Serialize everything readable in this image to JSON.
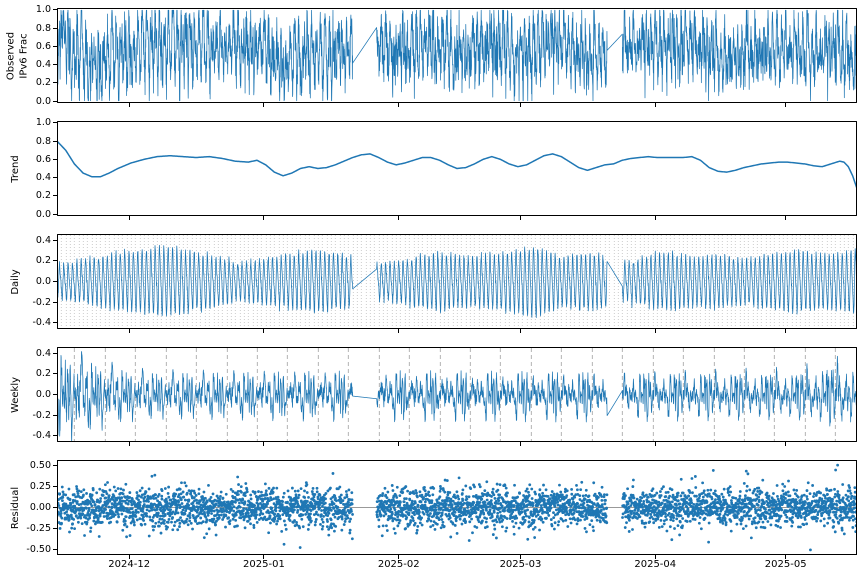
{
  "figure": {
    "background": "#ffffff",
    "line_color": "#1f77b4",
    "trend_line_color": "#1f77b4",
    "axis_color": "#000000",
    "daily_grid_color": "rgba(125,125,125,0.55)",
    "weekly_grid_color": "rgba(120,120,120,0.8)",
    "zero_line_color": "#999999"
  },
  "seed": 42,
  "x_axis": {
    "tick_labels": [
      "2024-12",
      "2025-01",
      "2025-02",
      "2025-03",
      "2025-04",
      "2025-05"
    ],
    "tick_days": [
      16.6,
      47.6,
      78.6,
      106.6,
      137.6,
      167.6
    ],
    "total_days": 184,
    "points_per_day": 24,
    "gaps_days": [
      [
        68.0,
        73.5
      ],
      [
        126.5,
        130.0
      ]
    ]
  },
  "chart_data": [
    {
      "id": "observed",
      "type": "line",
      "ylabel": "Observed\nIPv6 Frac",
      "ylim": [
        -0.02,
        1.02
      ],
      "yticks": [
        "0.0",
        "0.2",
        "0.4",
        "0.6",
        "0.8",
        "1.0"
      ],
      "ytick_values": [
        0.0,
        0.2,
        0.4,
        0.6,
        0.8,
        1.0
      ],
      "grid": null,
      "model": {
        "composition": "trend + daily + weekly + residual",
        "clip": [
          0.005,
          0.995
        ]
      }
    },
    {
      "id": "trend",
      "type": "line",
      "ylabel": "Trend",
      "ylim": [
        -0.02,
        1.02
      ],
      "yticks": [
        "0.0",
        "0.2",
        "0.4",
        "0.6",
        "0.8",
        "1.0"
      ],
      "ytick_values": [
        0.0,
        0.2,
        0.4,
        0.6,
        0.8,
        1.0
      ],
      "grid": null,
      "points": {
        "days": [
          0,
          2,
          4,
          6,
          8,
          10,
          12,
          14,
          17,
          20,
          23,
          26,
          29,
          32,
          35,
          38,
          41,
          44,
          46,
          48,
          50,
          52,
          54,
          56,
          58,
          60,
          62,
          64,
          66,
          68,
          70,
          72,
          74,
          76,
          78,
          80,
          82,
          84,
          86,
          88,
          90,
          92,
          94,
          96,
          98,
          100,
          102,
          104,
          106,
          108,
          110,
          112,
          114,
          116,
          118,
          120,
          122,
          124,
          126,
          128,
          130,
          132,
          134,
          136,
          138,
          140,
          142,
          144,
          146,
          148,
          150,
          152,
          154,
          156,
          158,
          160,
          162,
          164,
          166,
          168,
          170,
          172,
          174,
          176,
          178,
          180,
          181,
          182,
          183,
          184
        ],
        "values": [
          0.8,
          0.7,
          0.55,
          0.45,
          0.41,
          0.41,
          0.45,
          0.5,
          0.56,
          0.6,
          0.63,
          0.64,
          0.63,
          0.62,
          0.63,
          0.61,
          0.58,
          0.57,
          0.59,
          0.54,
          0.46,
          0.42,
          0.45,
          0.5,
          0.52,
          0.5,
          0.51,
          0.54,
          0.58,
          0.62,
          0.65,
          0.66,
          0.62,
          0.57,
          0.54,
          0.56,
          0.59,
          0.62,
          0.62,
          0.59,
          0.54,
          0.5,
          0.51,
          0.55,
          0.6,
          0.63,
          0.6,
          0.55,
          0.52,
          0.54,
          0.59,
          0.64,
          0.66,
          0.63,
          0.57,
          0.51,
          0.48,
          0.51,
          0.54,
          0.55,
          0.59,
          0.61,
          0.62,
          0.63,
          0.62,
          0.62,
          0.62,
          0.62,
          0.63,
          0.59,
          0.51,
          0.47,
          0.46,
          0.48,
          0.51,
          0.53,
          0.55,
          0.56,
          0.57,
          0.57,
          0.56,
          0.55,
          0.53,
          0.52,
          0.55,
          0.58,
          0.57,
          0.52,
          0.42,
          0.28
        ]
      }
    },
    {
      "id": "daily",
      "type": "line",
      "ylabel": "Daily",
      "ylim": [
        -0.46,
        0.46
      ],
      "yticks": [
        "-0.4",
        "-0.2",
        "0.0",
        "0.2",
        "0.4"
      ],
      "ytick_values": [
        -0.4,
        -0.2,
        0.0,
        0.2,
        0.4
      ],
      "grid": {
        "interval_days": 1,
        "phase_day": 0,
        "style": "dotted"
      },
      "model": {
        "peak_hour": 15,
        "harmonic_ratio": 0.3,
        "noise_std": 0.018,
        "amp_days": [
          0,
          6,
          12,
          18,
          24,
          30,
          36,
          42,
          48,
          54,
          60,
          66,
          68.5,
          73.5,
          76,
          82,
          88,
          94,
          100,
          106,
          110,
          112,
          116,
          120,
          126,
          130,
          134,
          140,
          146,
          152,
          158,
          164,
          170,
          176,
          180,
          184
        ],
        "amp_values": [
          0.16,
          0.2,
          0.26,
          0.3,
          0.33,
          0.3,
          0.24,
          0.18,
          0.22,
          0.26,
          0.3,
          0.26,
          0.22,
          0.16,
          0.18,
          0.24,
          0.28,
          0.24,
          0.26,
          0.3,
          0.34,
          0.3,
          0.24,
          0.27,
          0.25,
          0.18,
          0.22,
          0.28,
          0.24,
          0.26,
          0.22,
          0.26,
          0.3,
          0.26,
          0.28,
          0.32
        ]
      }
    },
    {
      "id": "weekly",
      "type": "line",
      "ylabel": "Weekly",
      "ylim": [
        -0.46,
        0.46
      ],
      "yticks": [
        "-0.4",
        "-0.2",
        "0.0",
        "0.2",
        "0.4"
      ],
      "ytick_values": [
        -0.4,
        -0.2,
        0.0,
        0.2,
        0.4
      ],
      "grid": {
        "interval_days": 7,
        "phase_day": 4,
        "style": "dashed"
      },
      "model": {
        "pattern_hours": 168,
        "std": 0.105,
        "smooth_window": 3,
        "envelope_days": [
          0,
          4,
          8,
          12,
          16,
          22,
          170,
          176,
          180,
          184
        ],
        "envelope_values": [
          1.9,
          1.8,
          1.5,
          1.3,
          1.1,
          1.0,
          1.0,
          1.25,
          1.35,
          1.2
        ]
      }
    },
    {
      "id": "residual",
      "type": "scatter",
      "ylabel": "Residual",
      "ylim": [
        -0.56,
        0.56
      ],
      "yticks": [
        "-0.50",
        "-0.25",
        "0.00",
        "0.25",
        "0.50"
      ],
      "ytick_values": [
        -0.5,
        -0.25,
        0.0,
        0.25,
        0.5
      ],
      "grid": null,
      "zero_line": true,
      "model": {
        "std": 0.11,
        "outlier_prob": 0.04,
        "outlier_scale": 1.9,
        "clip": 0.5,
        "dot_radius": 1.4
      }
    }
  ]
}
